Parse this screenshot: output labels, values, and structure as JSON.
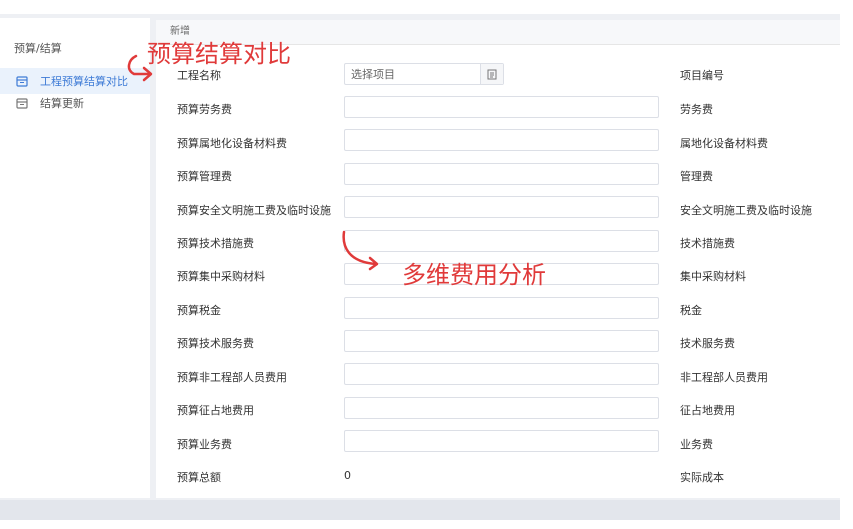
{
  "sidebar": {
    "title": "预算/结算",
    "items": [
      {
        "label": "工程预算结算对比",
        "active": true
      },
      {
        "label": "结算更新",
        "active": false
      }
    ]
  },
  "main": {
    "header": "新增"
  },
  "form": {
    "project_name_label": "工程名称",
    "project_select_placeholder": "选择项目",
    "project_code_label": "项目编号",
    "rows": [
      {
        "left": "预算劳务费",
        "right": "劳务费"
      },
      {
        "left": "预算属地化设备材料费",
        "right": "属地化设备材料费"
      },
      {
        "left": "预算管理费",
        "right": "管理费"
      },
      {
        "left": "预算安全文明施工费及临时设施",
        "right": "安全文明施工费及临时设施"
      },
      {
        "left": "预算技术措施费",
        "right": "技术措施费"
      },
      {
        "left": "预算集中采购材料",
        "right": "集中采购材料"
      },
      {
        "left": "预算税金",
        "right": "税金"
      },
      {
        "left": "预算技术服务费",
        "right": "技术服务费"
      },
      {
        "left": "预算非工程部人员费用",
        "right": "非工程部人员费用"
      },
      {
        "left": "预算征占地费用",
        "right": "征占地费用"
      },
      {
        "left": "预算业务费",
        "right": "业务费"
      }
    ],
    "total_label": "预算总额",
    "total_value": "0",
    "actual_cost_label": "实际成本"
  },
  "annotations": {
    "title_note": "预算结算对比",
    "analysis_note": "多维费用分析",
    "color": "#e03a3a"
  },
  "colors": {
    "accent": "#3e7bd6",
    "active_bg": "#eaf2fc",
    "annotation": "#e03a3a"
  }
}
